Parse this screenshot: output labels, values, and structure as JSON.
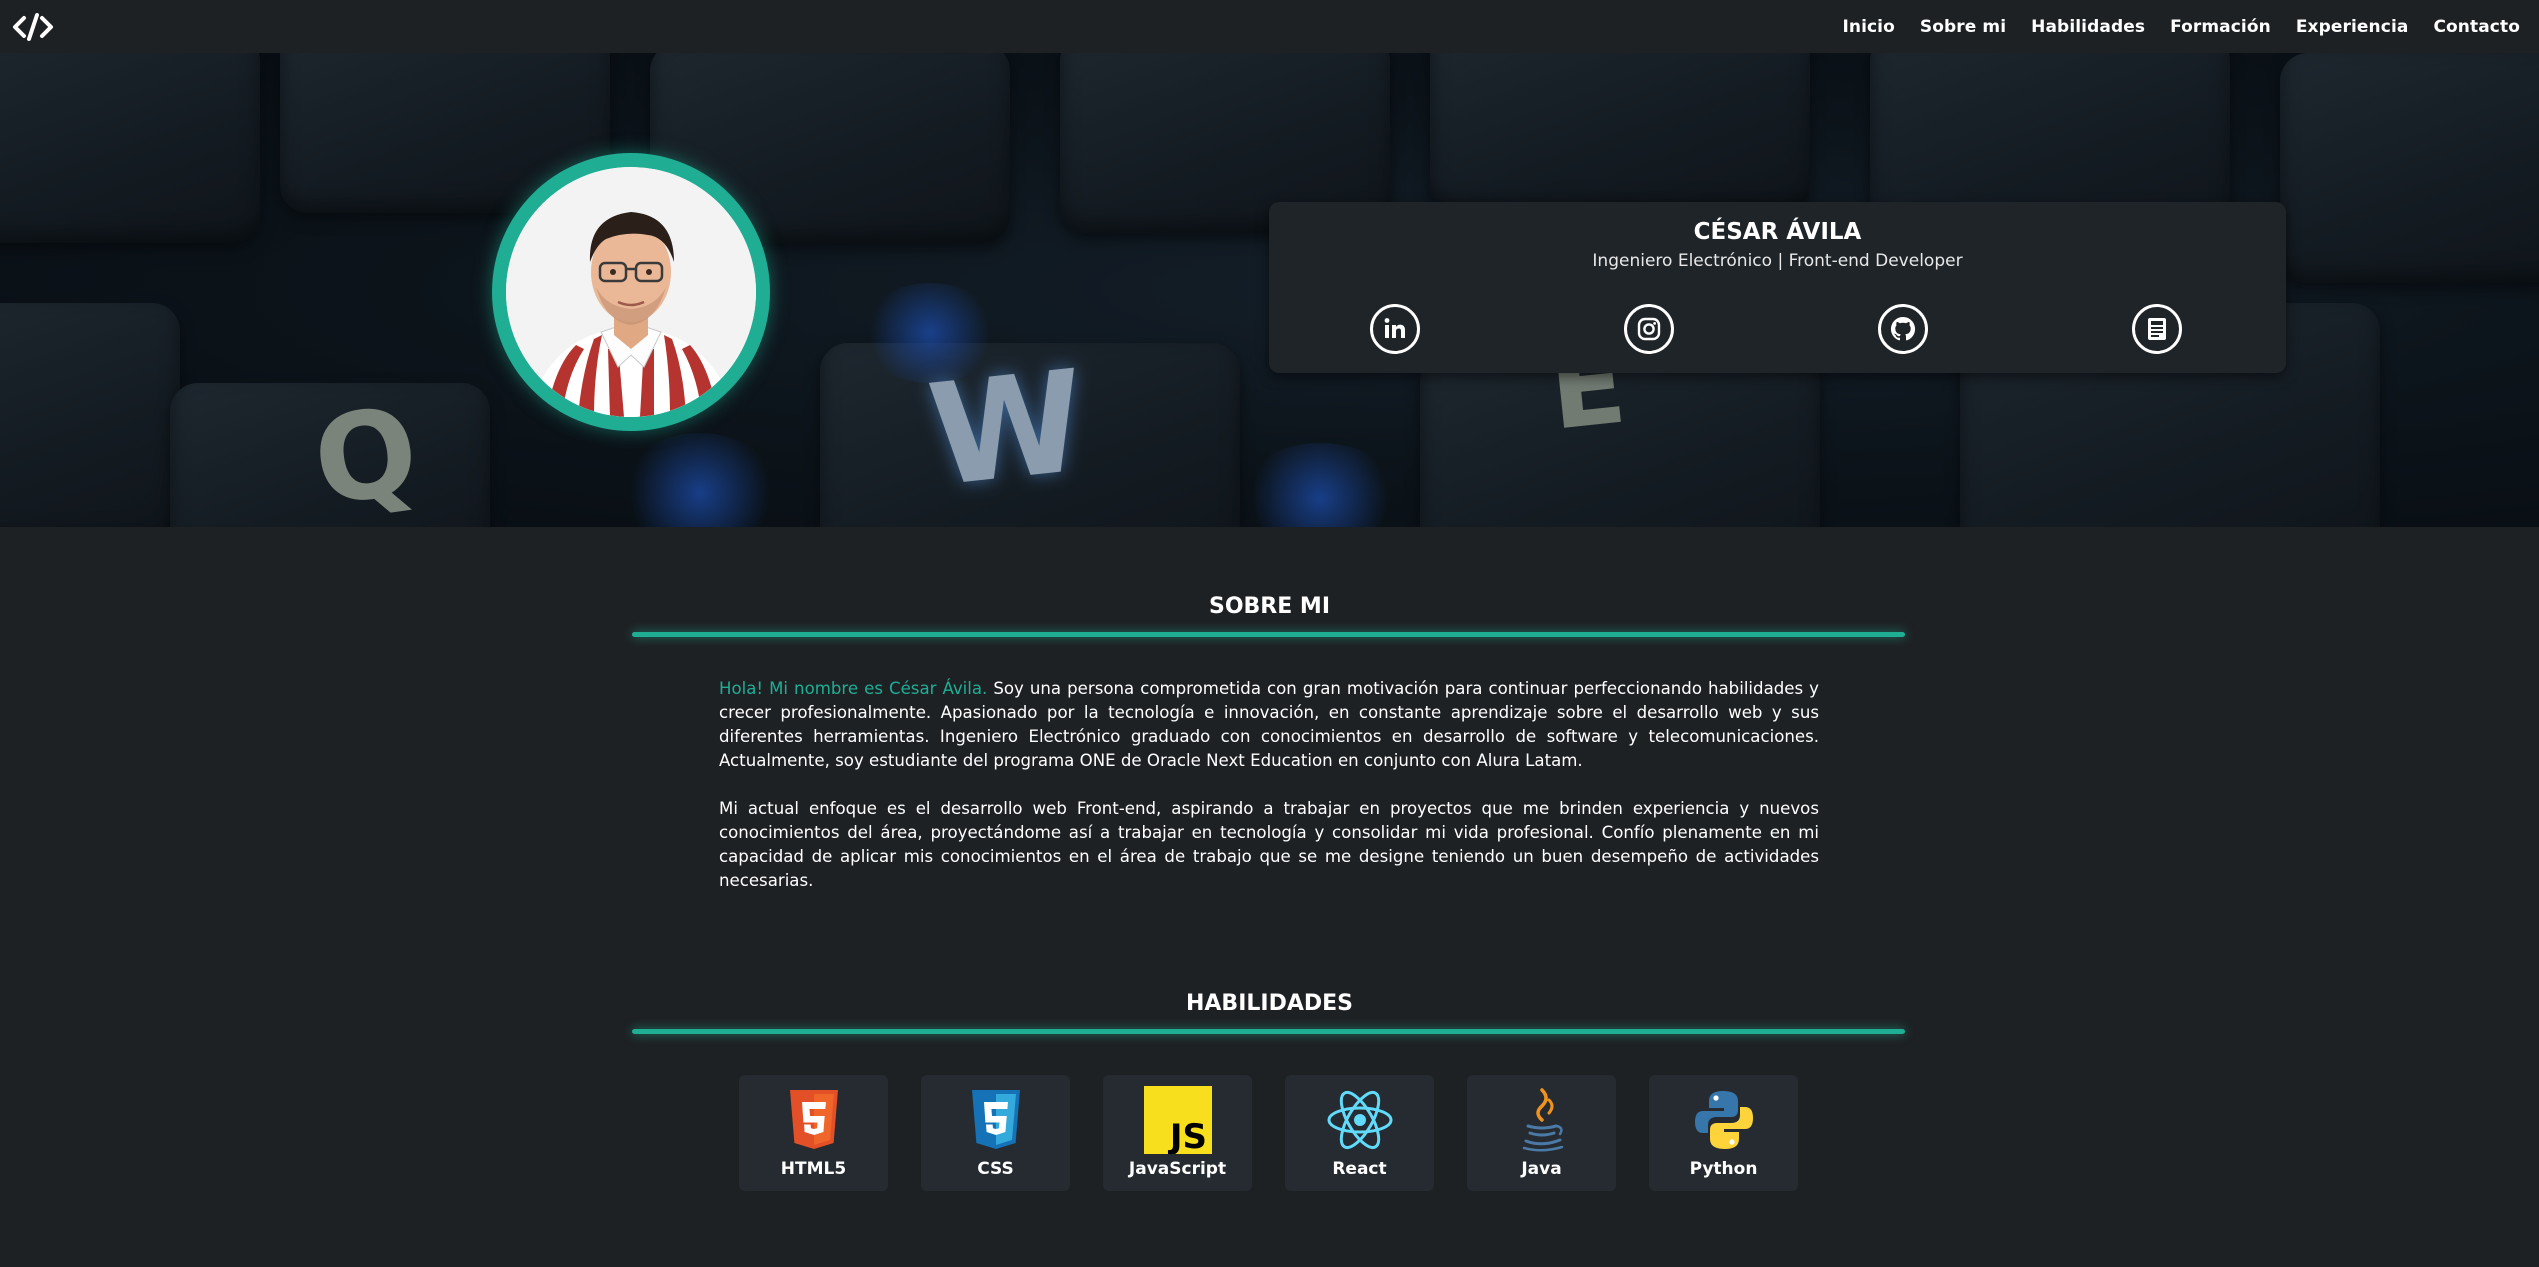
{
  "nav": {
    "logo_icon": "code-brackets-icon",
    "links": [
      "Inicio",
      "Sobre mi",
      "Habilidades",
      "Formación",
      "Experiencia",
      "Contacto"
    ]
  },
  "hero": {
    "background": "keyboard keys photo",
    "key_letters": [
      "Q",
      "W",
      "E"
    ],
    "name": "CÉSAR ÁVILA",
    "role": "Ingeniero Electrónico | Front-end Developer",
    "social_icons": [
      "linkedin-icon",
      "instagram-icon",
      "github-icon",
      "cv-document-icon"
    ],
    "accent_color": "#1fae94"
  },
  "about": {
    "title": "SOBRE MI",
    "greeting": "Hola! Mi nombre es César Ávila.",
    "paragraph1_rest": " Soy una persona comprometida con gran motivación para continuar perfeccionando habilidades y crecer profesionalmente. Apasionado por la tecnología e innovación, en constante aprendizaje sobre el desarrollo web y sus diferentes herramientas. Ingeniero Electrónico graduado con conocimientos en desarrollo de software y telecomunicaciones. Actualmente, soy estudiante del programa ONE de Oracle Next Education en conjunto con Alura Latam.",
    "paragraph2": "Mi actual enfoque es el desarrollo web Front-end, aspirando a trabajar en proyectos que me brinden experiencia y nuevos conocimientos del área, proyectándome así a trabajar en tecnología y consolidar mi vida profesional. Confío plenamente en mi capacidad de aplicar mis conocimientos en el área de trabajo que se me designe teniendo un buen desempeño de actividades necesarias."
  },
  "skills": {
    "title": "HABILIDADES",
    "items": [
      {
        "label": "HTML5",
        "icon": "html5-icon"
      },
      {
        "label": "CSS",
        "icon": "css3-icon"
      },
      {
        "label": "JavaScript",
        "icon": "javascript-icon"
      },
      {
        "label": "React",
        "icon": "react-icon"
      },
      {
        "label": "Java",
        "icon": "java-icon"
      },
      {
        "label": "Python",
        "icon": "python-icon"
      }
    ]
  },
  "colors": {
    "background": "#1e2124",
    "card": "#252b31",
    "accent": "#1fae94"
  }
}
